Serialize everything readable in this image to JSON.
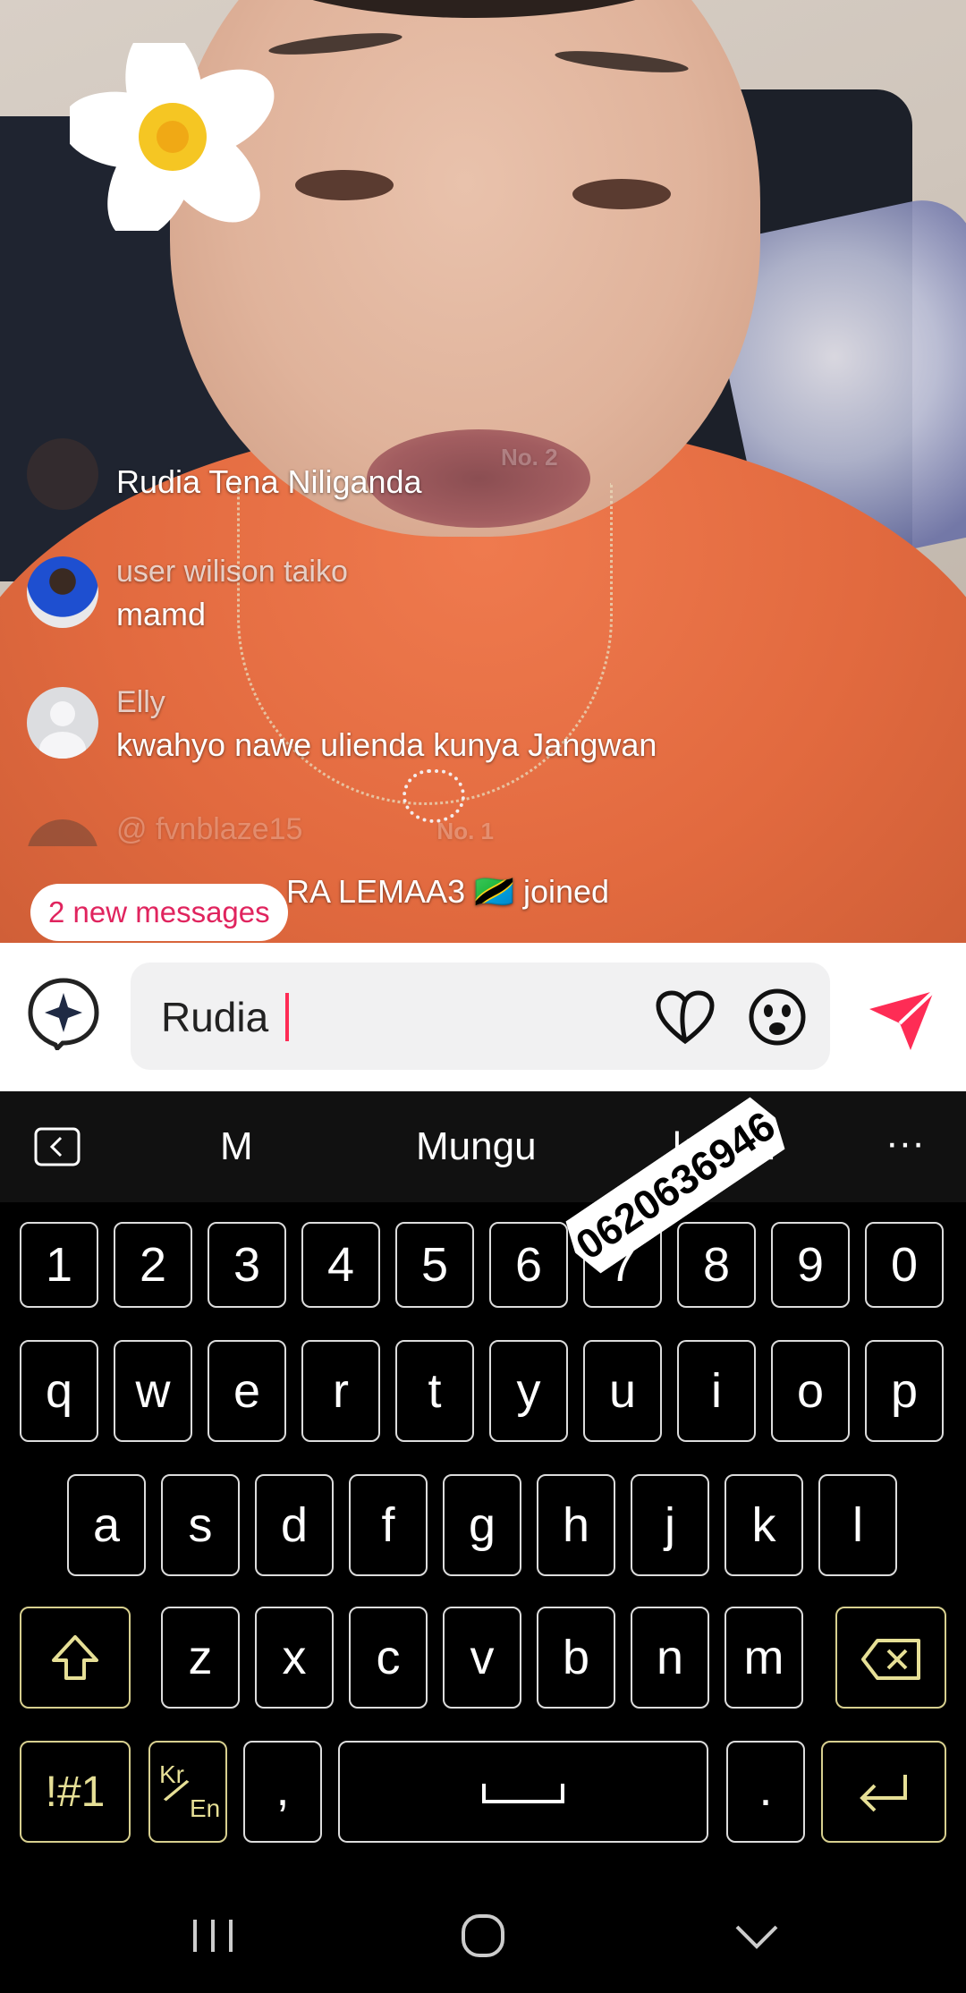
{
  "comments": [
    {
      "name": "",
      "badge": "No. 2",
      "text": "Rudia Tena Niliganda"
    },
    {
      "name": "user wilison taiko",
      "text": "mamd"
    },
    {
      "name": "Elly",
      "text": "kwahyo nawe ulienda kunya Jangwan"
    },
    {
      "name": "@ fvnblaze15",
      "badge": "No. 1",
      "text": ""
    }
  ],
  "join_notice": {
    "user_tail": "RA LEMAA3",
    "flag": "🇹🇿",
    "action": "joined"
  },
  "new_messages": "2 new messages",
  "input": {
    "value": "Rudia "
  },
  "suggestions": [
    "M",
    "Mungu",
    "kulani"
  ],
  "sticker_text": "0620636946",
  "keys": {
    "numbers": [
      "1",
      "2",
      "3",
      "4",
      "5",
      "6",
      "7",
      "8",
      "9",
      "0"
    ],
    "row1": [
      "q",
      "w",
      "e",
      "r",
      "t",
      "y",
      "u",
      "i",
      "o",
      "p"
    ],
    "row2": [
      "a",
      "s",
      "d",
      "f",
      "g",
      "h",
      "j",
      "k",
      "l"
    ],
    "row3": [
      "z",
      "x",
      "c",
      "v",
      "b",
      "n",
      "m"
    ],
    "symbols": "!#1",
    "lang_top": "Kr",
    "lang_bottom": "En",
    "comma": ",",
    "period": "."
  },
  "colors": {
    "accent": "#fe2c55",
    "fn_key": "#e6df96",
    "badge": "#e0245e"
  },
  "icons": [
    "ai-sparkle-icon",
    "heart-icon",
    "emoji-icon",
    "send-icon",
    "back-icon",
    "more-icon",
    "shift-icon",
    "backspace-icon",
    "enter-icon",
    "space-icon",
    "recents-icon",
    "home-icon",
    "nav-back-icon"
  ]
}
